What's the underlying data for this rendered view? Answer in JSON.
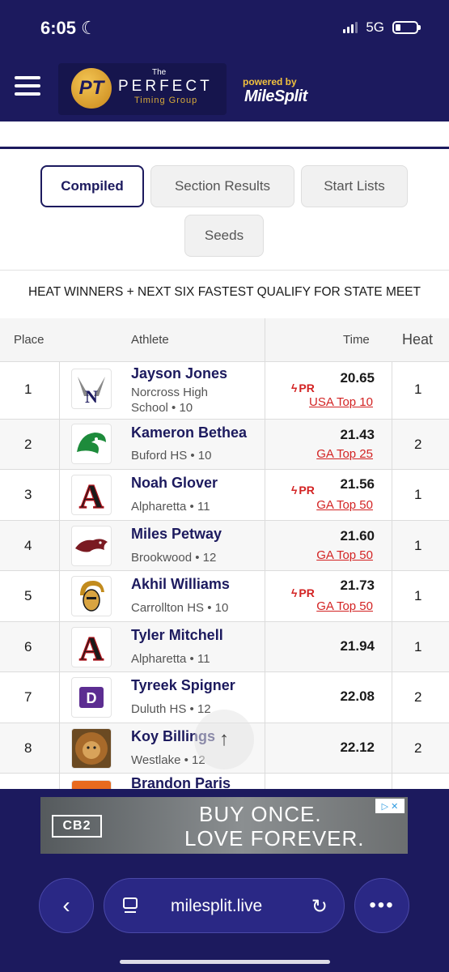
{
  "status": {
    "time": "6:05",
    "network": "5G"
  },
  "header": {
    "logo_the": "The",
    "logo_perfect": "PERFECT",
    "logo_sub": "Timing Group",
    "logo_mark": "PT",
    "powered_by": "powered by",
    "partner": "MileSplit"
  },
  "tabs": [
    {
      "label": "Compiled",
      "active": true
    },
    {
      "label": "Section Results",
      "active": false
    },
    {
      "label": "Start Lists",
      "active": false
    },
    {
      "label": "Seeds",
      "active": false
    }
  ],
  "notice": "HEAT WINNERS + NEXT SIX FASTEST QUALIFY FOR STATE MEET",
  "table": {
    "columns": {
      "place": "Place",
      "athlete": "Athlete",
      "time": "Time",
      "heat": "Heat"
    },
    "rows": [
      {
        "place": "1",
        "name": "Jayson Jones",
        "school": "Norcross High School • 10",
        "pr": "PR",
        "time": "20.65",
        "rank": "USA Top 10",
        "heat": "1",
        "logo": "norcross-logo"
      },
      {
        "place": "2",
        "name": "Kameron Bethea",
        "school": "Buford HS • 10",
        "pr": "",
        "time": "21.43",
        "rank": "GA Top 25",
        "heat": "2",
        "logo": "buford-logo"
      },
      {
        "place": "3",
        "name": "Noah Glover",
        "school": "Alpharetta • 11",
        "pr": "PR",
        "time": "21.56",
        "rank": "GA Top 50",
        "heat": "1",
        "logo": "alpharetta-logo"
      },
      {
        "place": "4",
        "name": "Miles Petway",
        "school": "Brookwood • 12",
        "pr": "",
        "time": "21.60",
        "rank": "GA Top 50",
        "heat": "1",
        "logo": "brookwood-logo"
      },
      {
        "place": "5",
        "name": "Akhil Williams",
        "school": "Carrollton HS • 10",
        "pr": "PR",
        "time": "21.73",
        "rank": "GA Top 50",
        "heat": "1",
        "logo": "carrollton-logo"
      },
      {
        "place": "6",
        "name": "Tyler Mitchell",
        "school": "Alpharetta • 11",
        "pr": "",
        "time": "21.94",
        "rank": "",
        "heat": "1",
        "logo": "alpharetta-logo"
      },
      {
        "place": "7",
        "name": "Tyreek Spigner",
        "school": "Duluth HS • 12",
        "pr": "",
        "time": "22.08",
        "rank": "",
        "heat": "2",
        "logo": "duluth-logo"
      },
      {
        "place": "8",
        "name": "Koy Billings",
        "school": "Westlake • 12",
        "pr": "",
        "time": "22.12",
        "rank": "",
        "heat": "2",
        "logo": "westlake-logo"
      },
      {
        "place": "",
        "name": "Brandon Paris",
        "school": "",
        "pr": "",
        "time": "",
        "rank": "",
        "heat": "",
        "logo": "partial-logo"
      }
    ]
  },
  "ad": {
    "brand": "CB2",
    "line1": "BUY ONCE.",
    "line2": "LOVE FOREVER."
  },
  "browser": {
    "url": "milesplit.live"
  },
  "colors": {
    "navy": "#1c1a5e",
    "pr_red": "#d32323",
    "gold": "#f2c23d"
  }
}
